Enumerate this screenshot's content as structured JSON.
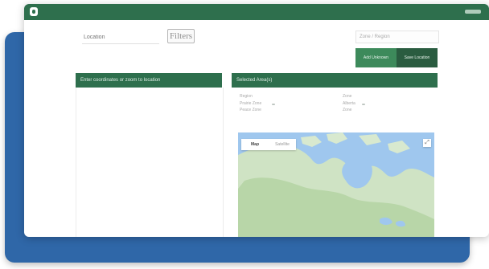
{
  "topbar": {
    "logo_icon": "app-logo-icon",
    "account_icon": "account-icon"
  },
  "search": {
    "placeholder": "Location",
    "button_label": "Filters"
  },
  "filter": {
    "selected": "Zone / Region"
  },
  "toolbar": {
    "add_label": "Add Unknown",
    "save_label": "Save Location"
  },
  "left_panel": {
    "header": "Enter coordinates or zoom to location"
  },
  "right_panel": {
    "header": "Selected Area(s)",
    "fields": [
      {
        "label": "Region",
        "value": "Prairie Zone",
        "extra": "Peace Zone"
      },
      {
        "label": "Zone",
        "value": "Alberta",
        "extra": "Zone"
      }
    ]
  },
  "map": {
    "tabs": [
      "Map",
      "Satellite"
    ],
    "active_tab": "Map",
    "fullscreen_icon": "fullscreen-icon",
    "colors": {
      "water": "#9fc7ee",
      "land": "#cfe3c4",
      "forest": "#b8d6a8"
    }
  }
}
